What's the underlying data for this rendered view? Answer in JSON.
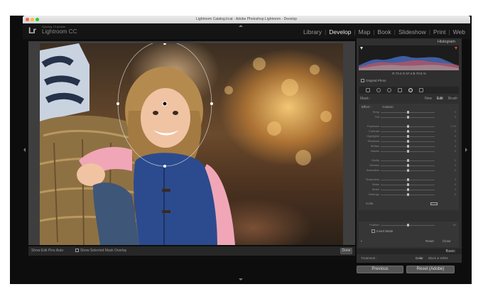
{
  "window": {
    "title": "Lightroom Catalog.lrcat - Adobe Photoshop Lightroom - Develop",
    "lights": [
      "#fc5f57",
      "#fdbc2e",
      "#28c840"
    ]
  },
  "identity": {
    "logo": "Lr",
    "syncing": "Syncing 13 photos",
    "product": "Lightroom CC"
  },
  "modules": [
    {
      "label": "Library",
      "active": false
    },
    {
      "label": "Develop",
      "active": true
    },
    {
      "label": "Map",
      "active": false
    },
    {
      "label": "Book",
      "active": false
    },
    {
      "label": "Slideshow",
      "active": false
    },
    {
      "label": "Print",
      "active": false
    },
    {
      "label": "Web",
      "active": false
    }
  ],
  "toolbar": {
    "show_edit_pins_label": "Show Edit Pins :",
    "show_edit_pins_value": "Auto",
    "mask_overlay_label": "Show Selected Mask Overlay",
    "done": "Done"
  },
  "panel": {
    "histogram_title": "Histogram",
    "readout": "R  73.4  G  67.4  B  70.5 %",
    "original_photo": "Original Photo",
    "mask_label": "Mask :",
    "mask_tabs": [
      "New",
      "Edit",
      "Brush"
    ],
    "effect_label": "Effect :",
    "effect_value": "Custom",
    "sliders": [
      {
        "label": "Temp",
        "value": "0",
        "pos": 0.5
      },
      {
        "label": "Tint",
        "value": "0",
        "pos": 0.5
      },
      {
        "label": "Exposure",
        "value": "0.00",
        "pos": 0.5
      },
      {
        "label": "Contrast",
        "value": "0",
        "pos": 0.5
      },
      {
        "label": "Highlights",
        "value": "0",
        "pos": 0.5
      },
      {
        "label": "Shadows",
        "value": "0",
        "pos": 0.5
      },
      {
        "label": "Whites",
        "value": "0",
        "pos": 0.5
      },
      {
        "label": "Blacks",
        "value": "0",
        "pos": 0.5
      },
      {
        "label": "Clarity",
        "value": "0",
        "pos": 0.5
      },
      {
        "label": "Dehaze",
        "value": "0",
        "pos": 0.5
      },
      {
        "label": "Saturation",
        "value": "0",
        "pos": 0.5
      },
      {
        "label": "Sharpness",
        "value": "0",
        "pos": 0.5
      },
      {
        "label": "Noise",
        "value": "0",
        "pos": 0.5
      },
      {
        "label": "Moiré",
        "value": "0",
        "pos": 0.5
      },
      {
        "label": "Defringe",
        "value": "0",
        "pos": 0.5
      }
    ],
    "color_label": "Color",
    "feather_label": "Feather",
    "feather_value": "50",
    "feather_pos": 0.5,
    "invert_mask": "Invert Mask",
    "reset": "Reset",
    "close": "Close",
    "basic_title": "Basic",
    "treatment_label": "Treatment :",
    "treatment_color": "Color",
    "treatment_bw": "Black & White"
  },
  "buttons": {
    "previous": "Previous",
    "reset_adobe": "Reset (Adobe)"
  }
}
